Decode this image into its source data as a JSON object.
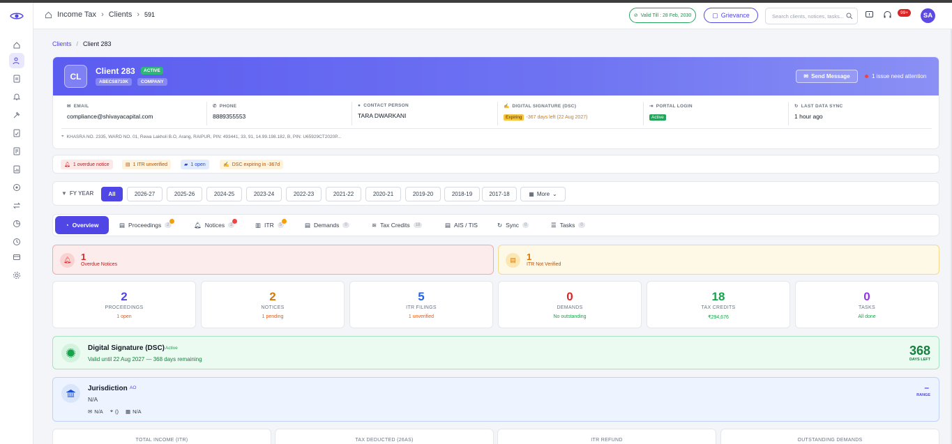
{
  "topbar": {
    "breadcrumb": [
      "Income Tax",
      "Clients",
      "591"
    ],
    "valid_till": "Valid Till : 28 Feb, 2030",
    "grievance": "Grievance",
    "search_placeholder": "Search clients, notices, tasks...",
    "notif_badge": "99+",
    "avatar": "SA"
  },
  "page_breadcrumb": {
    "link": "Clients",
    "sep": "/",
    "current": "Client 283"
  },
  "client": {
    "initials": "CL",
    "name": "Client 283",
    "status": "ACTIVE",
    "pan": "ABECS8710K",
    "type": "COMPANY",
    "send_message": "Send Message",
    "attention": "1 issue need attention",
    "fields": [
      {
        "label": "EMAIL",
        "value": "compliance@shivayacapital.com"
      },
      {
        "label": "PHONE",
        "value": "8889355553"
      },
      {
        "label": "CONTACT PERSON",
        "value": "TARA DWARKANI"
      },
      {
        "label": "DIGITAL SIGNATURE (DSC)",
        "badge": "Expiring",
        "value": "-367 days left (22 Aug 2027)"
      },
      {
        "label": "PORTAL LOGIN",
        "badge": "Active"
      },
      {
        "label": "LAST DATA SYNC",
        "value": "1 hour ago"
      }
    ],
    "address": "KHASRA NO. 2335, WARD NO. 01, Rewa Lakholi B.O, Arang, RAIPUR, PIN: 493441, 33, 91, 14.99.198.182, B, PIN: U65929CT2020P..."
  },
  "alerts": [
    {
      "text": "1 overdue notice",
      "tone": "red"
    },
    {
      "text": "1 ITR unverified",
      "tone": "amber"
    },
    {
      "text": "1 open",
      "tone": "blue"
    },
    {
      "text": "DSC expiring in -367d",
      "tone": "amber"
    }
  ],
  "fy": {
    "label": "FY YEAR",
    "years": [
      "All",
      "2026-27",
      "2025-26",
      "2024-25",
      "2023-24",
      "2022-23",
      "2021-22",
      "2020-21",
      "2019-20",
      "2018-19",
      "2017-18"
    ],
    "selected": "All",
    "more": "More"
  },
  "tabs": [
    {
      "label": "Overview"
    },
    {
      "label": "Proceedings",
      "count": "2"
    },
    {
      "label": "Notices",
      "count": "2"
    },
    {
      "label": "ITR",
      "count": "5"
    },
    {
      "label": "Demands",
      "count": "0"
    },
    {
      "label": "Tax Credits",
      "count": "18"
    },
    {
      "label": "AIS / TIS"
    },
    {
      "label": "Sync",
      "count": "0"
    },
    {
      "label": "Tasks",
      "count": "0"
    }
  ],
  "warnings": [
    {
      "num": "1",
      "label": "Overdue Notices"
    },
    {
      "num": "1",
      "label": "ITR Not Verified"
    }
  ],
  "stats": [
    {
      "num": "2",
      "label": "PROCEEDINGS",
      "sub": "1 open",
      "color": "#4f46e5",
      "subcolor": "#ea580c"
    },
    {
      "num": "2",
      "label": "NOTICES",
      "sub": "1 pending",
      "color": "#d97706",
      "subcolor": "#ea580c"
    },
    {
      "num": "5",
      "label": "ITR FILINGS",
      "sub": "1 unverified",
      "color": "#2563eb",
      "subcolor": "#ea580c"
    },
    {
      "num": "0",
      "label": "DEMANDS",
      "sub": "No outstanding",
      "color": "#dc2626",
      "subcolor": "#16a34a"
    },
    {
      "num": "18",
      "label": "TAX CREDITS",
      "sub": "₹294,676",
      "color": "#16a34a",
      "subcolor": "#16a34a"
    },
    {
      "num": "0",
      "label": "TASKS",
      "sub": "All done",
      "color": "#9333ea",
      "subcolor": "#16a34a"
    }
  ],
  "dsc": {
    "title": "Digital Signature (DSC)",
    "status": "Active",
    "valid": "Valid until 22 Aug 2027 — 368 days remaining",
    "days": "368",
    "days_label": "DAYS LEFT"
  },
  "jurisdiction": {
    "title": "Jurisdiction",
    "tag": "AO",
    "value": "N/A",
    "meta": [
      "N/A",
      "()",
      "N/A"
    ],
    "range_value": "–",
    "range_label": "RANGE"
  },
  "bottom_cards": [
    "TOTAL INCOME (ITR)",
    "TAX DEDUCTED (26AS)",
    "ITR REFUND",
    "OUTSTANDING DEMANDS"
  ]
}
